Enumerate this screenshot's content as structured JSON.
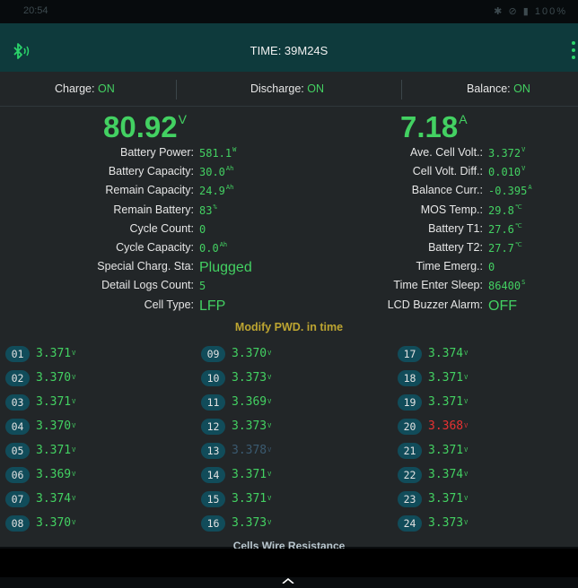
{
  "status_bar": {
    "time": "20:54",
    "battery_pct": "100%"
  },
  "header": {
    "title": "TIME: 39M24S"
  },
  "toggles": [
    {
      "label": "Charge:",
      "value": "ON"
    },
    {
      "label": "Discharge:",
      "value": "ON"
    },
    {
      "label": "Balance:",
      "value": "ON"
    }
  ],
  "voltage": {
    "value": "80.92",
    "unit": "V"
  },
  "current": {
    "value": "7.18",
    "unit": "A"
  },
  "left_stats": [
    {
      "label": "Battery Power:",
      "value": "581.1",
      "unit": "W"
    },
    {
      "label": "Battery Capacity:",
      "value": "30.0",
      "unit": "Ah"
    },
    {
      "label": "Remain Capacity:",
      "value": "24.9",
      "unit": "Ah"
    },
    {
      "label": "Remain Battery:",
      "value": "83",
      "unit": "%"
    },
    {
      "label": "Cycle Count:",
      "value": "0",
      "unit": ""
    },
    {
      "label": "Cycle Capacity:",
      "value": "0.0",
      "unit": "Ah"
    },
    {
      "label": "Special Charg. Sta:",
      "value": "Plugged",
      "unit": ""
    },
    {
      "label": "Detail Logs Count:",
      "value": "5",
      "unit": ""
    },
    {
      "label": "Cell Type:",
      "value": "LFP",
      "unit": ""
    }
  ],
  "right_stats": [
    {
      "label": "Ave. Cell Volt.:",
      "value": "3.372",
      "unit": "V"
    },
    {
      "label": "Cell Volt. Diff.:",
      "value": "0.010",
      "unit": "V"
    },
    {
      "label": "Balance Curr.:",
      "value": "-0.395",
      "unit": "A"
    },
    {
      "label": "MOS Temp.:",
      "value": "29.8",
      "unit": "℃"
    },
    {
      "label": "Battery T1:",
      "value": "27.6",
      "unit": "℃"
    },
    {
      "label": "Battery T2:",
      "value": "27.7",
      "unit": "℃"
    },
    {
      "label": "Time Emerg.:",
      "value": "0",
      "unit": ""
    },
    {
      "label": "Time Enter Sleep:",
      "value": "86400",
      "unit": "S"
    },
    {
      "label": "LCD Buzzer Alarm:",
      "value": "OFF",
      "unit": ""
    }
  ],
  "modify_pwd": "Modify PWD. in time",
  "cell_unit": "V",
  "cells": [
    {
      "id": "01",
      "v": "3.371",
      "state": "normal"
    },
    {
      "id": "02",
      "v": "3.370",
      "state": "normal"
    },
    {
      "id": "03",
      "v": "3.371",
      "state": "normal"
    },
    {
      "id": "04",
      "v": "3.370",
      "state": "normal"
    },
    {
      "id": "05",
      "v": "3.371",
      "state": "normal"
    },
    {
      "id": "06",
      "v": "3.369",
      "state": "normal"
    },
    {
      "id": "07",
      "v": "3.374",
      "state": "normal"
    },
    {
      "id": "08",
      "v": "3.370",
      "state": "normal"
    },
    {
      "id": "09",
      "v": "3.370",
      "state": "normal"
    },
    {
      "id": "10",
      "v": "3.373",
      "state": "normal"
    },
    {
      "id": "11",
      "v": "3.369",
      "state": "normal"
    },
    {
      "id": "12",
      "v": "3.373",
      "state": "normal"
    },
    {
      "id": "13",
      "v": "3.378",
      "state": "max"
    },
    {
      "id": "14",
      "v": "3.371",
      "state": "normal"
    },
    {
      "id": "15",
      "v": "3.371",
      "state": "normal"
    },
    {
      "id": "16",
      "v": "3.373",
      "state": "normal"
    },
    {
      "id": "17",
      "v": "3.374",
      "state": "normal"
    },
    {
      "id": "18",
      "v": "3.371",
      "state": "normal"
    },
    {
      "id": "19",
      "v": "3.371",
      "state": "normal"
    },
    {
      "id": "20",
      "v": "3.368",
      "state": "min"
    },
    {
      "id": "21",
      "v": "3.371",
      "state": "normal"
    },
    {
      "id": "22",
      "v": "3.374",
      "state": "normal"
    },
    {
      "id": "23",
      "v": "3.371",
      "state": "normal"
    },
    {
      "id": "24",
      "v": "3.373",
      "state": "normal"
    }
  ],
  "cells_wire_resistance": "Cells Wire Resistance",
  "colors": {
    "accent_green": "#43d162",
    "alert_red": "#e83232",
    "badge_bg": "#114c5a",
    "header_bg": "#0e3a3c",
    "panel_bg": "#222628",
    "modify_gold": "#bda531"
  },
  "icons": {
    "bluetooth": "bluetooth-icon",
    "menu": "overflow-menu-icon",
    "home": "home-chevron-icon"
  }
}
